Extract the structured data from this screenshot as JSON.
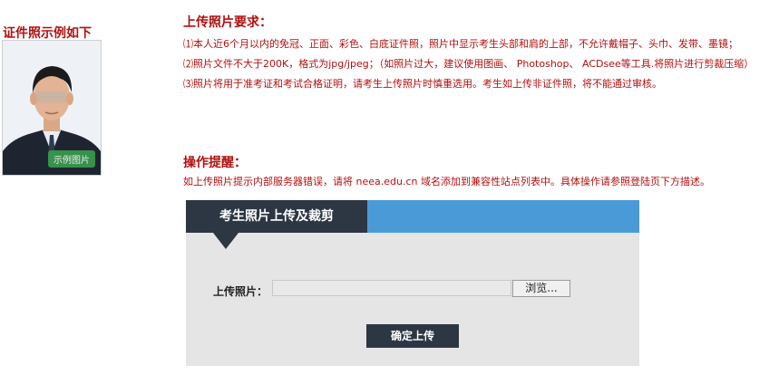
{
  "sample": {
    "title": "证件照示例如下",
    "badge": "示例图片"
  },
  "requirements": {
    "title": "上传照片要求：",
    "items": [
      "⑴本人近6个月以内的免冠、正面、彩色、白底证件照，照片中显示考生头部和肩的上部，不允许戴帽子、头巾、发带、墨镜；",
      "⑵照片文件不大于200K，格式为jpg/jpeg；（如照片过大，建议使用图画、 Photoshop、 ACDsee等工具.将照片进行剪裁压缩）",
      "⑶照片将用于准考证和考试合格证明，请考生上传照片时慎重选用。考生如上传非证件照，将不能通过审核。"
    ]
  },
  "tips": {
    "title": "操作提醒：",
    "text": "如上传照片提示内部服务器错误，请将 neea.edu.cn 域名添加到兼容性站点列表中。具体操作请参照登陆页下方描述。"
  },
  "upload_panel": {
    "tab_title": "考生照片上传及裁剪",
    "field_label": "上传照片：",
    "file_value": "",
    "browse_label": "浏览...",
    "submit_label": "确定上传"
  },
  "colors": {
    "accent_red": "#b21010",
    "tab_dark": "#2d3643",
    "header_blue": "#4a9ad7",
    "badge_green": "#3a9b4c"
  }
}
